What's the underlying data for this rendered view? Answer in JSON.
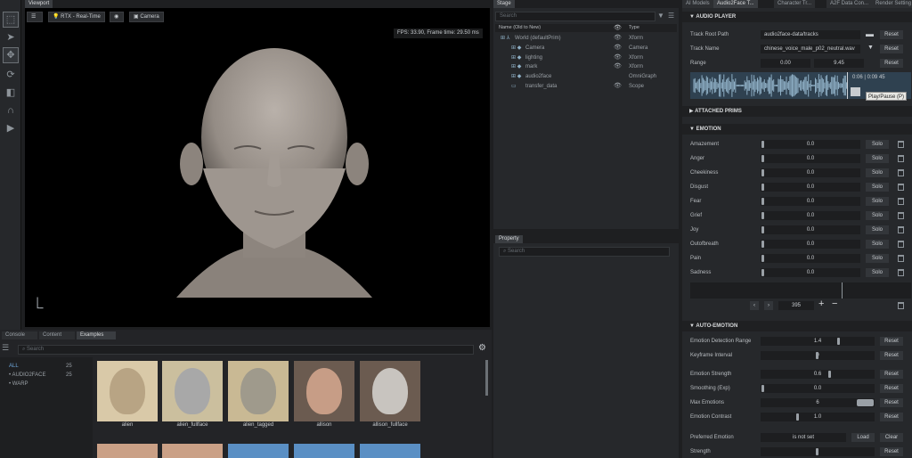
{
  "viewport": {
    "tab": "Viewport",
    "renderer": "RTX - Real-Time",
    "camera": "Camera",
    "fps_text": "FPS: 33.90, Frame time: 29.50 ms"
  },
  "stage": {
    "tab": "Stage",
    "search_placeholder": "Search",
    "col_name": "Name (Old to New)",
    "col_type": "Type",
    "rows": [
      {
        "name": "World (defaultPrim)",
        "type": "Xform"
      },
      {
        "name": "Camera",
        "type": "Camera"
      },
      {
        "name": "lighting",
        "type": "Xform"
      },
      {
        "name": "mark",
        "type": "Xform"
      },
      {
        "name": "audio2face",
        "type": "OmniGraph"
      },
      {
        "name": "transfer_data",
        "type": "Scope"
      }
    ]
  },
  "property": {
    "tab": "Property",
    "search_placeholder": "Search"
  },
  "right_tabs": [
    "AI Models",
    "Audio2Face T...",
    "Character Tr...",
    "A2F Data Con...",
    "Render Setting"
  ],
  "audio_player": {
    "title": "AUDIO PLAYER",
    "track_root_label": "Track Root Path",
    "track_root_value": "audio2face-data/tracks",
    "track_name_label": "Track Name",
    "track_name_value": "chinese_voice_male_p02_neutral.wav",
    "range_label": "Range",
    "range_start": "0.00",
    "range_end": "9.45",
    "reset_label": "Reset",
    "time_current": "0:06",
    "time_total": "0:09",
    "time_extra": "45",
    "tooltip": "Play/Pause (P)"
  },
  "attached_prims": {
    "title": "ATTACHED PRIMS"
  },
  "emotion": {
    "title": "EMOTION",
    "solo_label": "Solo",
    "items": [
      {
        "name": "Amazement",
        "value": "0.0"
      },
      {
        "name": "Anger",
        "value": "0.0"
      },
      {
        "name": "Cheekiness",
        "value": "0.0"
      },
      {
        "name": "Disgust",
        "value": "0.0"
      },
      {
        "name": "Fear",
        "value": "0.0"
      },
      {
        "name": "Grief",
        "value": "0.0"
      },
      {
        "name": "Joy",
        "value": "0.0"
      },
      {
        "name": "Outofbreath",
        "value": "0.0"
      },
      {
        "name": "Pain",
        "value": "0.0"
      },
      {
        "name": "Sadness",
        "value": "0.0"
      }
    ],
    "frame": "395"
  },
  "auto_emotion": {
    "title": "AUTO-EMOTION",
    "reset_label": "Reset",
    "rows": [
      {
        "name": "Emotion Detection Range",
        "value": "1.4"
      },
      {
        "name": "Keyframe Interval",
        "value": "0"
      },
      {
        "name": "Emotion Strength",
        "value": "0.6"
      },
      {
        "name": "Smoothing (Exp)",
        "value": "0.0"
      },
      {
        "name": "Max Emotions",
        "value": "6"
      },
      {
        "name": "Emotion Contrast",
        "value": "1.0"
      }
    ],
    "preferred_label": "Preferred Emotion",
    "preferred_value": "is not set",
    "load_label": "Load",
    "clear_label": "Clear",
    "strength_label": "Strength"
  },
  "bottom": {
    "tabs": [
      "Console",
      "Content",
      "Examples"
    ],
    "search_placeholder": "Search",
    "categories": [
      {
        "name": "ALL",
        "count": "25"
      },
      {
        "name": "AUDIO2FACE",
        "count": "25"
      },
      {
        "name": "WARP",
        "count": ""
      }
    ],
    "thumbnails": [
      "alien",
      "alien_fullface",
      "alien_tagged",
      "allison",
      "allison_fullface"
    ]
  }
}
